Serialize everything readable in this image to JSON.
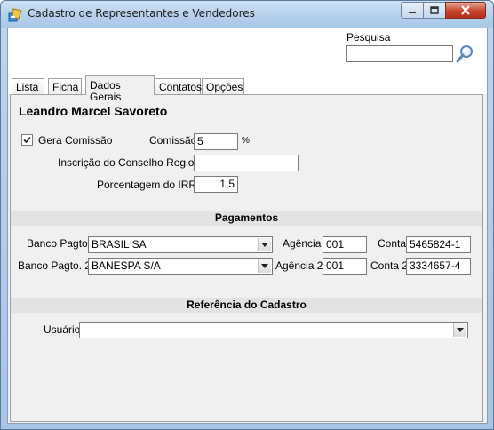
{
  "window": {
    "title": "Cadastro de Representantes e Vendedores"
  },
  "search": {
    "label": "Pesquisa",
    "value": ""
  },
  "tabs": [
    {
      "label": "Lista"
    },
    {
      "label": "Ficha"
    },
    {
      "label": "Dados Gerais"
    },
    {
      "label": "Contatos"
    },
    {
      "label": "Opções"
    }
  ],
  "active_tab": "Dados Gerais",
  "record": {
    "name": "Leandro Marcel Savoreto"
  },
  "commission": {
    "checkbox_label": "Gera Comissão",
    "checked": true,
    "commission_label": "Comissão",
    "commission_value": "5",
    "unit": "%",
    "council_label": "Inscrição do Conselho Regional",
    "council_value": "",
    "irrf_label": "Porcentagem do IRRF",
    "irrf_value": "1,5"
  },
  "payments": {
    "header": "Pagamentos",
    "bank1_label": "Banco Pagto.",
    "bank1_value": "BRASIL SA",
    "agency1_label": "Agência",
    "agency1_value": "001",
    "account1_label": "Conta",
    "account1_value": "5465824-1",
    "bank2_label": "Banco Pagto. 2",
    "bank2_value": "BANESPA S/A",
    "agency2_label": "Agência 2",
    "agency2_value": "001",
    "account2_label": "Conta 2",
    "account2_value": "3334657-4"
  },
  "reference": {
    "header": "Referência do Cadastro",
    "user_label": "Usuário",
    "user_value": ""
  },
  "colors": {
    "titlebar": "#b9d3ee",
    "close_button": "#c7442b",
    "panel": "#f0f0f0"
  }
}
